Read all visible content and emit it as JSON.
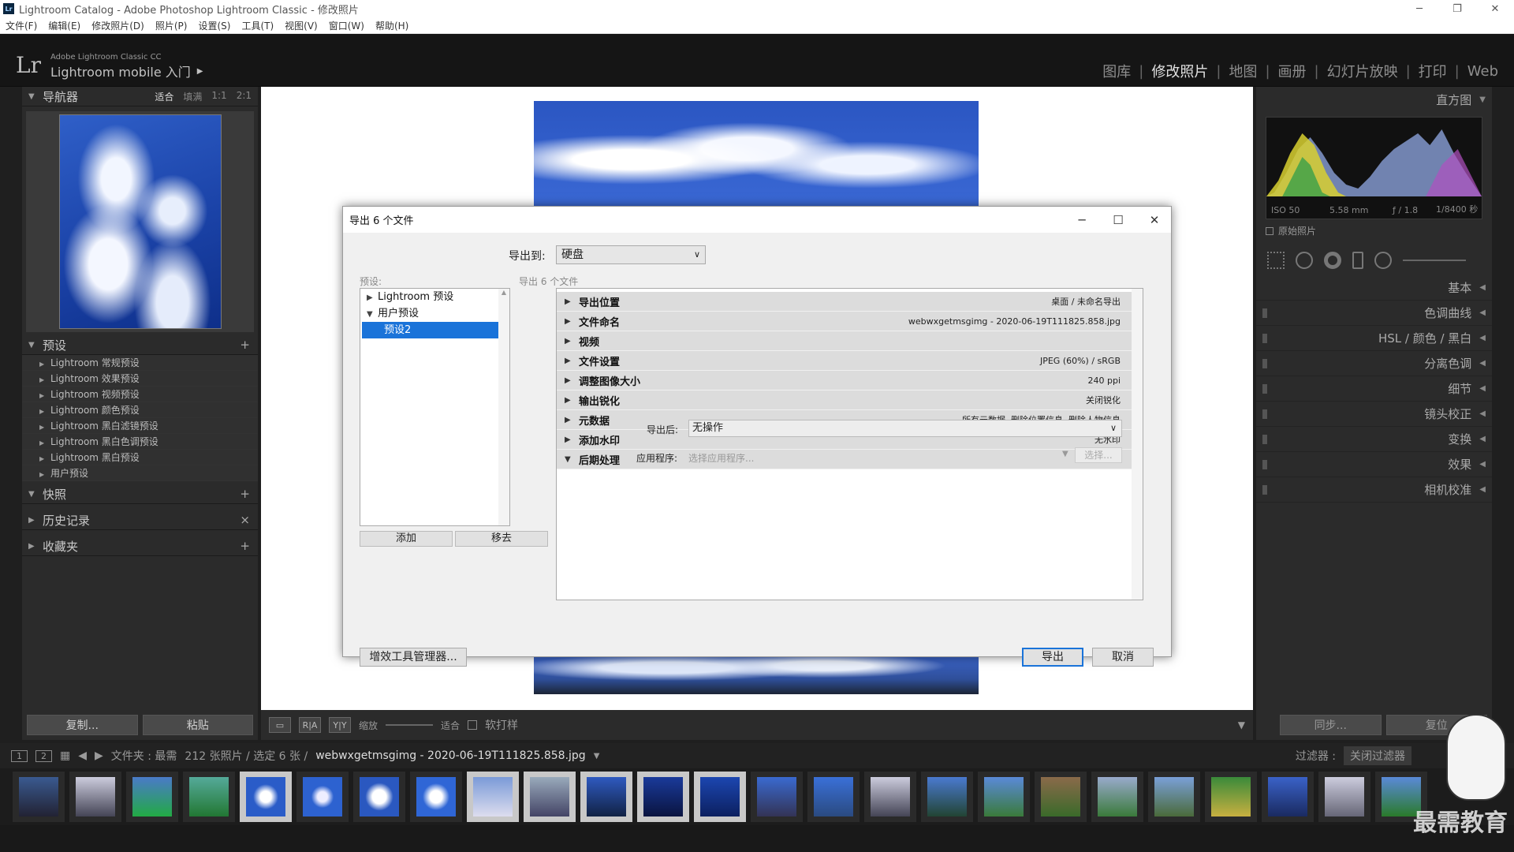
{
  "window": {
    "title": "Lightroom Catalog - Adobe Photoshop Lightroom Classic - 修改照片",
    "app_icon": "Lr"
  },
  "menu": [
    "文件(F)",
    "编辑(E)",
    "修改照片(D)",
    "照片(P)",
    "设置(S)",
    "工具(T)",
    "视图(V)",
    "窗口(W)",
    "帮助(H)"
  ],
  "identity": {
    "logo": "Lr",
    "brand_line1": "Adobe Lightroom Classic CC",
    "brand_line2": "Lightroom mobile 入门",
    "arrow": "▶"
  },
  "modules": [
    {
      "label": "图库"
    },
    {
      "label": "修改照片",
      "active": true
    },
    {
      "label": "地图"
    },
    {
      "label": "画册"
    },
    {
      "label": "幻灯片放映"
    },
    {
      "label": "打印"
    },
    {
      "label": "Web"
    }
  ],
  "left": {
    "navigator": {
      "title": "导航器",
      "opts": [
        "适合",
        "填满",
        "1:1",
        "2:1"
      ]
    },
    "presets": {
      "title": "预设",
      "items": [
        "Lightroom 常规预设",
        "Lightroom 效果预设",
        "Lightroom 视频预设",
        "Lightroom 颜色预设",
        "Lightroom 黑白滤镜预设",
        "Lightroom 黑白色调预设",
        "Lightroom 黑白预设",
        "用户预设"
      ]
    },
    "snapshots": "快照",
    "history": "历史记录",
    "collections": "收藏夹",
    "copy": "复制...",
    "paste": "粘贴"
  },
  "toolbar": {
    "zoom_label": "缩放",
    "fit_label": "适合",
    "softproof": "软打样",
    "yy": "Y|Y",
    "ra": "R|A"
  },
  "right": {
    "histogram": "直方图",
    "hist_info": [
      "ISO 50",
      "5.58 mm",
      "ƒ / 1.8",
      "1/8400 秒"
    ],
    "original": "原始照片",
    "panels": [
      "基本",
      "色调曲线",
      "HSL / 颜色 / 黑白",
      "分离色调",
      "细节",
      "镜头校正",
      "变换",
      "效果",
      "相机校准"
    ],
    "sync": "同步...",
    "reset": "复位"
  },
  "filmbar": {
    "views": [
      "1",
      "2"
    ],
    "source": "文件夹 : 最需",
    "count": "212 张照片 / 选定 6 张 /",
    "filename": "webwxgetmsgimg - 2020-06-19T111825.858.jpg",
    "filter_label": "过滤器 :",
    "filter_value": "关闭过滤器"
  },
  "dialog": {
    "title": "导出 6 个文件",
    "export_to_label": "导出到:",
    "export_to_value": "硬盘",
    "preset_label": "预设:",
    "count_label": "导出 6 个文件",
    "presets": [
      {
        "label": "Lightroom 预设",
        "tri": "▶"
      },
      {
        "label": "用户预设",
        "tri": "▼"
      },
      {
        "label": "预设2",
        "selected": true
      }
    ],
    "add": "添加",
    "remove": "移去",
    "sections": [
      {
        "name": "导出位置",
        "summary": "桌面 / 未命名导出"
      },
      {
        "name": "文件命名",
        "summary": "webwxgetmsgimg - 2020-06-19T111825.858.jpg"
      },
      {
        "name": "视频",
        "summary": ""
      },
      {
        "name": "文件设置",
        "summary": "JPEG (60%) / sRGB"
      },
      {
        "name": "调整图像大小",
        "summary": "240 ppi"
      },
      {
        "name": "输出锐化",
        "summary": "关闭锐化"
      },
      {
        "name": "元数据",
        "summary": "所有元数据, 删除位置信息, 删除人物信息"
      },
      {
        "name": "添加水印",
        "summary": "无水印"
      },
      {
        "name": "后期处理",
        "summary": "",
        "open": true
      }
    ],
    "after_label": "导出后:",
    "after_value": "无操作",
    "app_label": "应用程序:",
    "app_placeholder": "选择应用程序...",
    "choose": "选择...",
    "plugin_manager": "增效工具管理器...",
    "export": "导出",
    "cancel": "取消"
  },
  "watermark": "最需教育",
  "colors": {
    "accent": "#1a73d9",
    "panel": "#2b2b2b",
    "identity": "#151515"
  }
}
